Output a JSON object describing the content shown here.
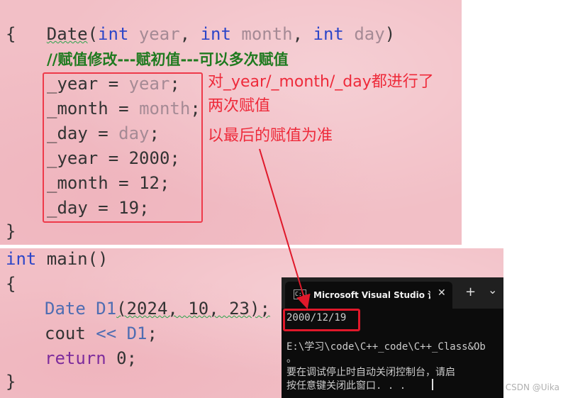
{
  "top_code": {
    "signature": {
      "name": "Date",
      "open": "(",
      "t1": "int",
      "p1": " year",
      "sep1": ", ",
      "t2": "int",
      "p2": " month",
      "sep2": ", ",
      "t3": "int",
      "p3": " day",
      "close": ")"
    },
    "open_brace": "{",
    "comment": "//赋值修改---赋初值---可以多次赋值",
    "assignments": [
      {
        "lhs": "_year",
        "op": " = ",
        "rhs": "year",
        "end": ";"
      },
      {
        "lhs": "_month",
        "op": " = ",
        "rhs": "month",
        "end": ";"
      },
      {
        "lhs": "_day",
        "op": " = ",
        "rhs": "day",
        "end": ";"
      },
      {
        "lhs": "_year",
        "op": " = ",
        "rhs": "2000",
        "end": ";"
      },
      {
        "lhs": "_month",
        "op": " = ",
        "rhs": "12",
        "end": ";"
      },
      {
        "lhs": "_day",
        "op": " = ",
        "rhs": "19",
        "end": ";"
      }
    ],
    "close_brace": "}"
  },
  "annotations": {
    "line1": "对_year/_month/_day都进行了",
    "line2": "两次赋值",
    "line3": "以最后的赋值为准"
  },
  "bottom_code": {
    "main_type": "int",
    "main_sig": " main()",
    "open_brace": "{",
    "decl": {
      "type": "Date",
      "name": " D1",
      "args": "(2024, 10, 23);"
    },
    "cout": {
      "kw": "cout",
      "op": " << ",
      "arg": "D1",
      "end": ";"
    },
    "ret": {
      "kw": "return",
      "val": " 0;"
    },
    "close_brace": "}"
  },
  "terminal": {
    "icon_glyph": "C:\\",
    "tab_title": "Microsoft Visual Studio 调试控",
    "close": "✕",
    "add": "+",
    "chevron": "⌄",
    "output": "2000/12/19",
    "path_line": "E:\\学习\\code\\C++_code\\C++_Class&Ob",
    "dot_line": "。",
    "msg1": "要在调试停止时自动关闭控制台，请启",
    "msg2": "按任意键关闭此窗口. . ."
  },
  "watermark": "CSDN @Uika",
  "colors": {
    "annotation_red": "#ee2a3a",
    "comment_green": "#1f7a1f",
    "keyword_blue": "#2d46c8",
    "panel_pink": "#f2bfc6"
  }
}
